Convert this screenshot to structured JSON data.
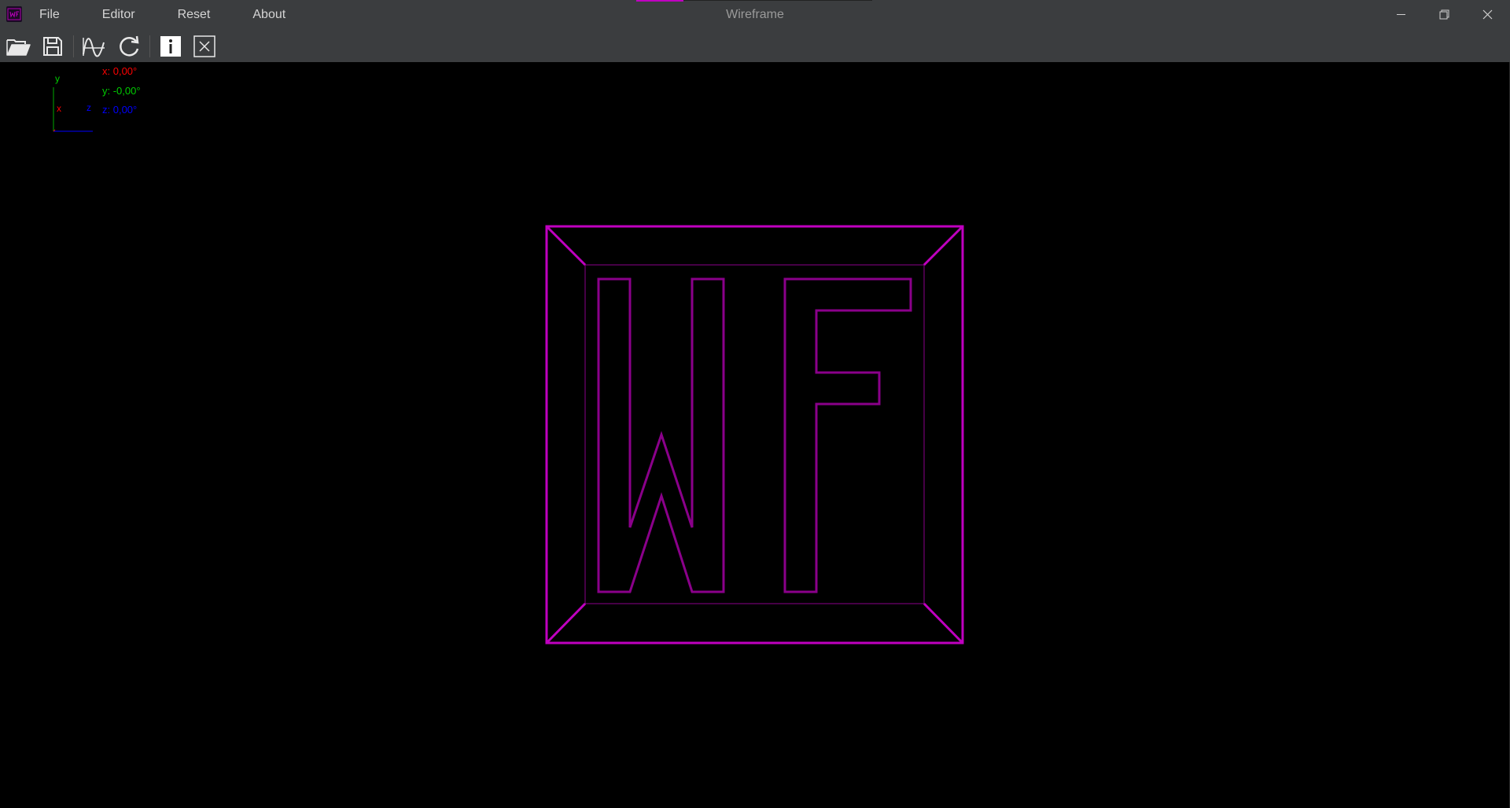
{
  "app": {
    "title": "Wireframe"
  },
  "menu": {
    "file": "File",
    "editor": "Editor",
    "reset": "Reset",
    "about": "About"
  },
  "toolbar": {
    "icons": [
      "folder-open-icon",
      "save-icon",
      "wave-icon",
      "refresh-icon",
      "info-icon",
      "close-box-icon"
    ]
  },
  "axes": {
    "y_label": "y",
    "x_label": "x",
    "z_label": "z",
    "x_angle": "x: 0,00°",
    "y_angle": "y: -0,00°",
    "z_angle": "z: 0,00°",
    "colors": {
      "x": "#ff0000",
      "y": "#00cc00",
      "z": "#0000ff"
    }
  },
  "scene": {
    "color": "#c000c0",
    "inner_color": "#8a008a"
  }
}
